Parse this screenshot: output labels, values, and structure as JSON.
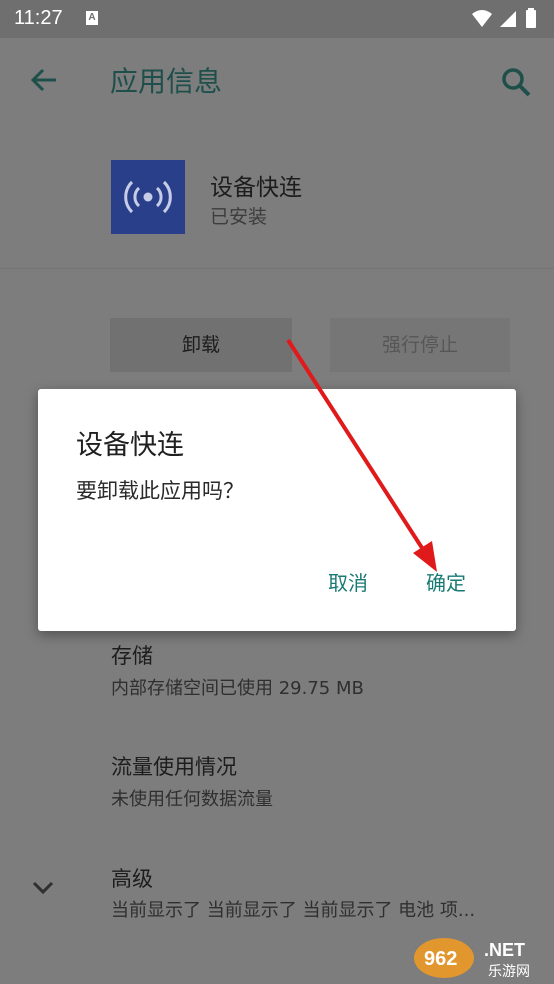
{
  "status_bar": {
    "time": "11:27",
    "notification_letter": "A"
  },
  "app_bar": {
    "title": "应用信息",
    "back_icon": "arrow-left-icon",
    "search_icon": "search-icon"
  },
  "app": {
    "name": "设备快连",
    "status": "已安装",
    "icon": "broadcast-icon",
    "icon_color": "#2a3f8a"
  },
  "buttons": {
    "uninstall": "卸载",
    "force_stop": "强行停止"
  },
  "items": [
    {
      "title": "存储",
      "subtitle": "内部存储空间已使用 29.75 MB"
    },
    {
      "title": "流量使用情况",
      "subtitle": "未使用任何数据流量"
    },
    {
      "title": "高级",
      "subtitle": "当前显示了 当前显示了 当前显示了 电池 项..."
    }
  ],
  "dialog": {
    "title": "设备快连",
    "message": "要卸载此应用吗？",
    "cancel": "取消",
    "confirm": "确定"
  },
  "colors": {
    "accent": "#1a7a73",
    "arrow": "#e0191b"
  },
  "watermark": {
    "site": "962.NET",
    "tagline": "乐游网"
  }
}
